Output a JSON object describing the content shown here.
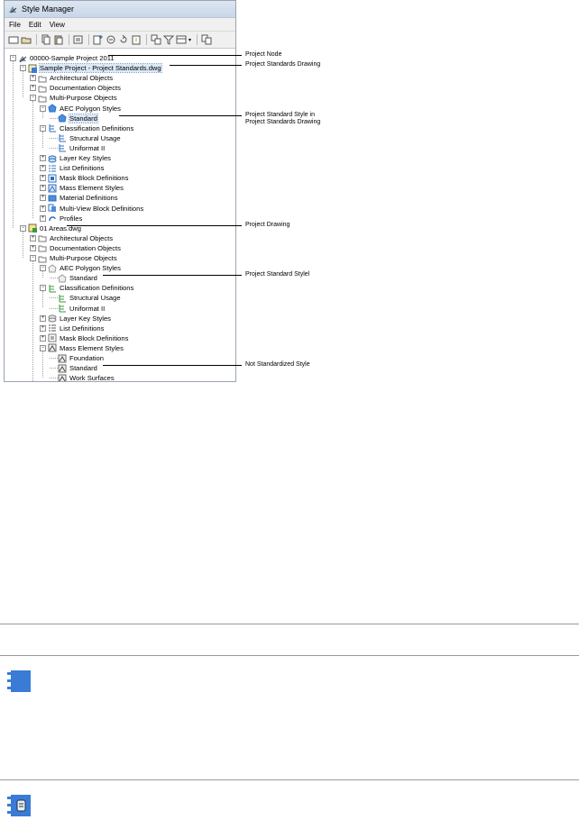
{
  "window": {
    "title": "Style Manager"
  },
  "menu": [
    "File",
    "Edit",
    "View"
  ],
  "tree": [
    {
      "label": "00000-Sample Project 2011",
      "indent": 0,
      "icon": "project",
      "expander": "-"
    },
    {
      "label": "Sample Project - Project Standards.dwg",
      "indent": 1,
      "icon": "drawing-std",
      "expander": "-",
      "highlight": true
    },
    {
      "label": "Architectural Objects",
      "indent": 2,
      "icon": "folder",
      "expander": "+"
    },
    {
      "label": "Documentation Objects",
      "indent": 2,
      "icon": "folder",
      "expander": "+"
    },
    {
      "label": "Multi-Purpose Objects",
      "indent": 2,
      "icon": "folder",
      "expander": "-"
    },
    {
      "label": "AEC Polygon Styles",
      "indent": 3,
      "icon": "polygon",
      "expander": "-"
    },
    {
      "label": "Standard",
      "indent": 4,
      "icon": "polygon",
      "expander": "",
      "highlight": true
    },
    {
      "label": "Classification Definitions",
      "indent": 3,
      "icon": "classification",
      "expander": "-"
    },
    {
      "label": "Structural Usage",
      "indent": 4,
      "icon": "classification",
      "expander": ""
    },
    {
      "label": "Uniformat II",
      "indent": 4,
      "icon": "classification",
      "expander": ""
    },
    {
      "label": "Layer Key Styles",
      "indent": 3,
      "icon": "layerkey",
      "expander": "+"
    },
    {
      "label": "List Definitions",
      "indent": 3,
      "icon": "list",
      "expander": "+"
    },
    {
      "label": "Mask Block Definitions",
      "indent": 3,
      "icon": "mask",
      "expander": "+"
    },
    {
      "label": "Mass Element Styles",
      "indent": 3,
      "icon": "mass",
      "expander": "+"
    },
    {
      "label": "Material Definitions",
      "indent": 3,
      "icon": "material",
      "expander": "+"
    },
    {
      "label": "Multi-View Block Definitions",
      "indent": 3,
      "icon": "mvblock",
      "expander": "+"
    },
    {
      "label": "Profiles",
      "indent": 3,
      "icon": "profile",
      "expander": "+"
    },
    {
      "label": "01 Areas.dwg",
      "indent": 1,
      "icon": "drawing",
      "expander": "-"
    },
    {
      "label": "Architectural Objects",
      "indent": 2,
      "icon": "folder",
      "expander": "+"
    },
    {
      "label": "Documentation Objects",
      "indent": 2,
      "icon": "folder",
      "expander": "+"
    },
    {
      "label": "Multi-Purpose Objects",
      "indent": 2,
      "icon": "folder",
      "expander": "-"
    },
    {
      "label": "AEC Polygon Styles",
      "indent": 3,
      "icon": "polygon-gray",
      "expander": "-"
    },
    {
      "label": "Standard",
      "indent": 4,
      "icon": "polygon-gray",
      "expander": ""
    },
    {
      "label": "Classification Definitions",
      "indent": 3,
      "icon": "classification-green",
      "expander": "-"
    },
    {
      "label": "Structural Usage",
      "indent": 4,
      "icon": "classification-green",
      "expander": ""
    },
    {
      "label": "Uniformat II",
      "indent": 4,
      "icon": "classification-green",
      "expander": ""
    },
    {
      "label": "Layer Key Styles",
      "indent": 3,
      "icon": "layerkey-gray",
      "expander": "+"
    },
    {
      "label": "List Definitions",
      "indent": 3,
      "icon": "list-gray",
      "expander": "+"
    },
    {
      "label": "Mask Block Definitions",
      "indent": 3,
      "icon": "mask-gray",
      "expander": "+"
    },
    {
      "label": "Mass Element Styles",
      "indent": 3,
      "icon": "mass-gray",
      "expander": "-"
    },
    {
      "label": "Foundation",
      "indent": 4,
      "icon": "mass-gray",
      "expander": ""
    },
    {
      "label": "Standard",
      "indent": 4,
      "icon": "mass-gray",
      "expander": ""
    },
    {
      "label": "Work Surfaces",
      "indent": 4,
      "icon": "mass-gray",
      "expander": ""
    }
  ],
  "callouts": [
    {
      "text": "Project Node",
      "row": 0
    },
    {
      "text": "Project Standards Drawing",
      "row": 1
    },
    {
      "text": "Project Standard Style in\nProject Standards Drawing",
      "row": 6
    },
    {
      "text": "Project Drawing",
      "row": 17
    },
    {
      "text": "Project Standard Stylel",
      "row": 22
    },
    {
      "text": "Not Standardized Style",
      "row": 31
    }
  ],
  "colors": {
    "accent_blue": "#2e6fc0",
    "folder": "#8a8a8a",
    "green": "#3a9a3a"
  }
}
